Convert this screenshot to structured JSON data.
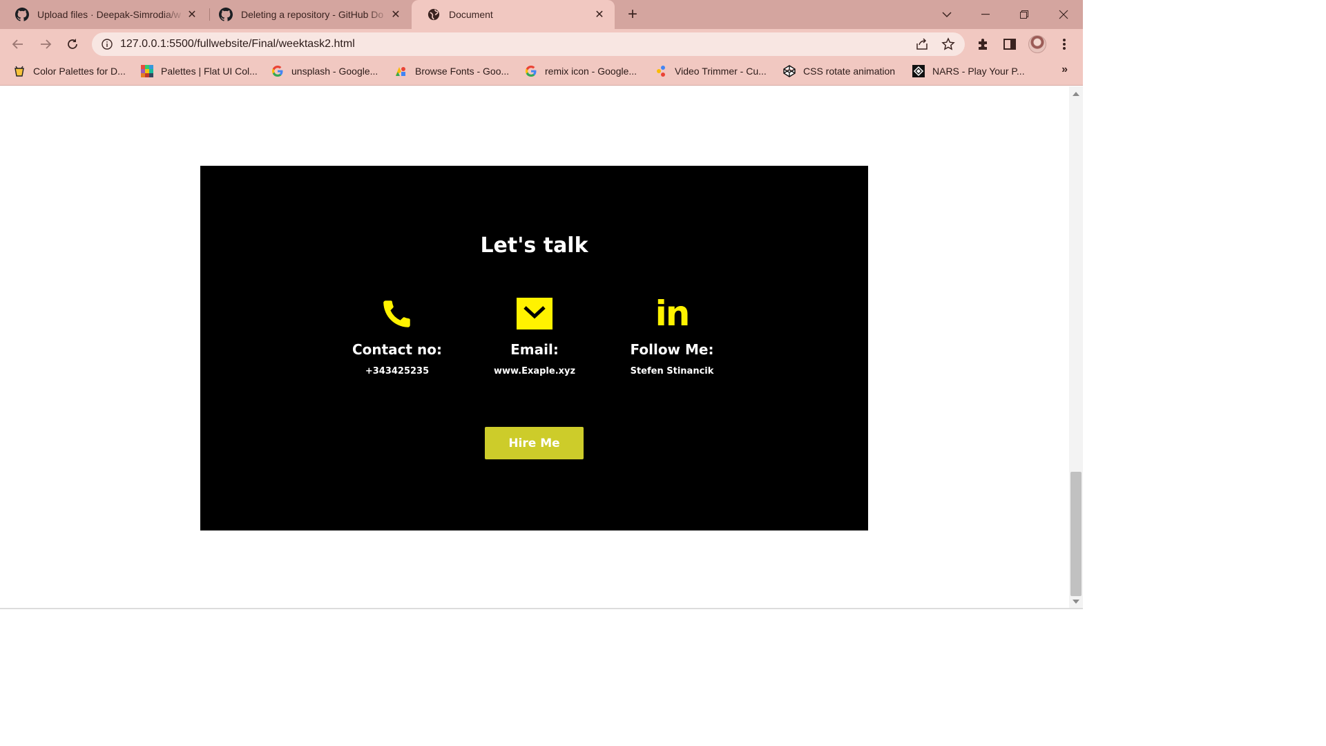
{
  "browser": {
    "tabs": [
      {
        "title": "Upload files · Deepak-Simrodia/w",
        "favicon": "github-icon",
        "active": false
      },
      {
        "title": "Deleting a repository - GitHub Do",
        "favicon": "github-icon",
        "active": false
      },
      {
        "title": "Document",
        "favicon": "globe-icon",
        "active": true
      }
    ],
    "new_tab_label": "+",
    "url": "127.0.0.1:5500/fullwebsite/Final/weektask2.html",
    "bookmarks": [
      {
        "label": "Color Palettes for D...",
        "icon": "palette-site-icon"
      },
      {
        "label": "Palettes | Flat UI Col...",
        "icon": "flatui-icon"
      },
      {
        "label": "unsplash - Google...",
        "icon": "google-icon"
      },
      {
        "label": "Browse Fonts - Goo...",
        "icon": "google-fonts-icon"
      },
      {
        "label": "remix icon - Google...",
        "icon": "google-icon"
      },
      {
        "label": "Video Trimmer - Cu...",
        "icon": "video-trimmer-icon"
      },
      {
        "label": "CSS rotate animation",
        "icon": "codepen-icon"
      },
      {
        "label": "NARS - Play Your P...",
        "icon": "nars-icon"
      }
    ],
    "bookmarks_overflow": "»"
  },
  "page": {
    "heading": "Let's talk",
    "contacts": [
      {
        "icon": "phone-icon",
        "label": "Contact no:",
        "value": "+343425235"
      },
      {
        "icon": "mail-icon",
        "label": "Email:",
        "value": "www.Exaple.xyz"
      },
      {
        "icon": "linkedin-icon",
        "label": "Follow Me:",
        "value": "Stefen Stinancik",
        "icon_text": "in"
      }
    ],
    "cta_label": "Hire Me"
  },
  "colors": {
    "accent_yellow": "#fff200",
    "button": "#cdcc2a",
    "card": "#000000",
    "browser_frame": "#f1c8c1"
  }
}
